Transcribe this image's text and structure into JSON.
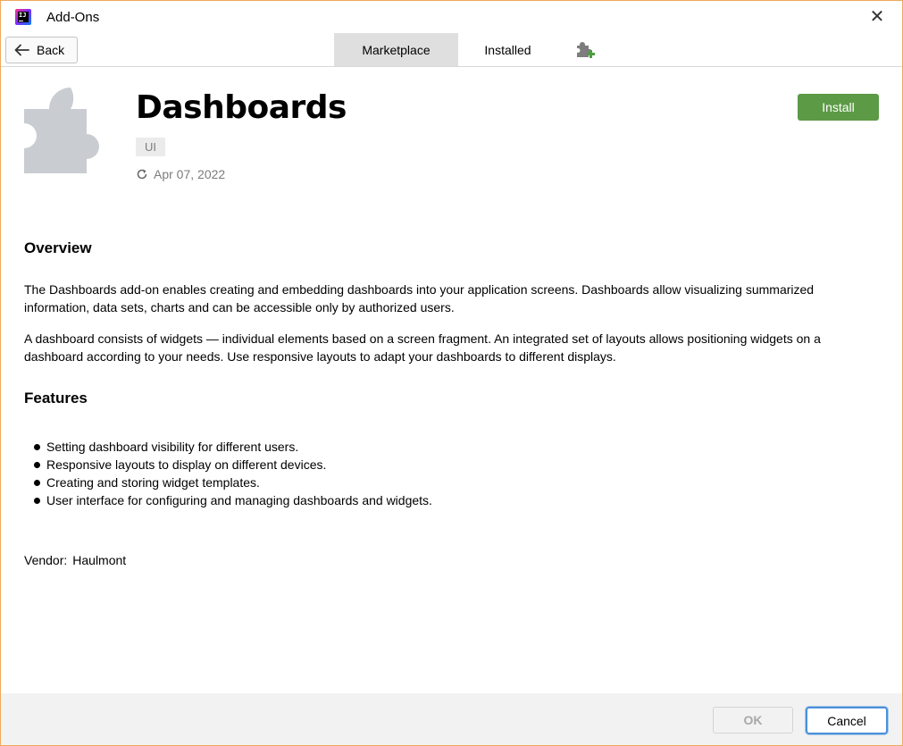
{
  "window": {
    "title": "Add-Ons",
    "icon": "intellij-idea-icon"
  },
  "toolbar": {
    "back_label": "Back",
    "tabs": [
      {
        "label": "Marketplace",
        "selected": true
      },
      {
        "label": "Installed",
        "selected": false
      }
    ],
    "extra_icon": "plugin-add-icon"
  },
  "plugin": {
    "name": "Dashboards",
    "tag": "UI",
    "date": "Apr 07, 2022",
    "install_label": "Install",
    "overview_heading": "Overview",
    "overview_paragraphs": [
      "The Dashboards add-on enables creating and embedding dashboards into your application screens. Dashboards allow visualizing summarized information, data sets, charts and can be accessible only by authorized users.",
      "A dashboard consists of widgets — individual elements based on a screen fragment. An integrated set of layouts allows positioning widgets on a dashboard according to your needs. Use responsive layouts to adapt your dashboards to different displays."
    ],
    "features_heading": "Features",
    "features": [
      "Setting dashboard visibility for different users.",
      "Responsive layouts to display on different devices.",
      "Creating and storing widget templates.",
      "User interface for configuring and managing dashboards and widgets."
    ],
    "vendor_label": "Vendor:",
    "vendor_name": "Haulmont"
  },
  "footer": {
    "ok_label": "OK",
    "cancel_label": "Cancel"
  },
  "colors": {
    "install_green": "#5c9a46",
    "window_border": "#f0a95c",
    "focus_blue": "#4a90d9",
    "selected_tab_bg": "#dfdfdf"
  }
}
